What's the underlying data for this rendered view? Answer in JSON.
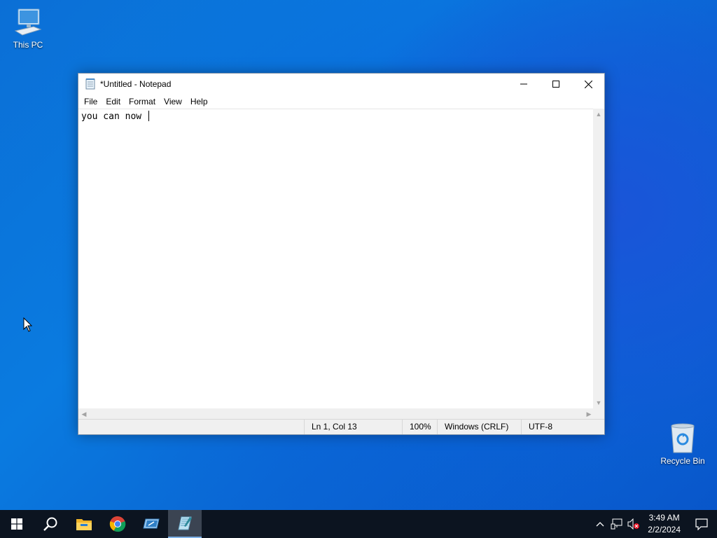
{
  "desktop": {
    "icons": [
      {
        "label": "This PC"
      },
      {
        "label": "Recycle Bin"
      }
    ]
  },
  "notepad": {
    "title": "*Untitled - Notepad",
    "menu": [
      "File",
      "Edit",
      "Format",
      "View",
      "Help"
    ],
    "content": "you can now ",
    "status": {
      "position": "Ln 1, Col 13",
      "zoom": "100%",
      "line_endings": "Windows (CRLF)",
      "encoding": "UTF-8"
    }
  },
  "taskbar": {
    "apps": [
      "start-icon",
      "search-icon",
      "file-explorer-icon",
      "chrome-icon",
      "remote-desktop-icon",
      "notepad-icon"
    ],
    "clock": {
      "time": "3:49 AM",
      "date": "2/2/2024"
    }
  },
  "colors": {
    "desktop": "#0a6fd8",
    "taskbar": "#0c1420",
    "active_task": "#3b4452"
  }
}
